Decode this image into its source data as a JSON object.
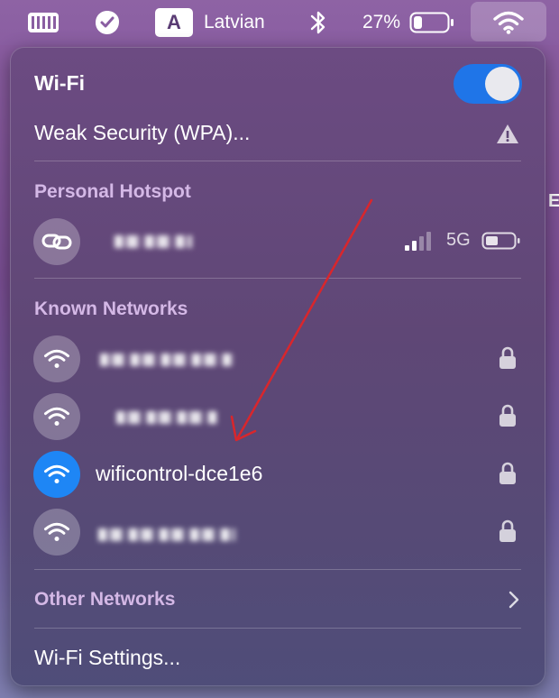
{
  "menubar": {
    "input_source_letter": "A",
    "input_source_label": "Latvian",
    "battery_percent": "27%",
    "battery_level": 0.27,
    "icons": [
      "battery-status-icon",
      "checkmark-badge-icon",
      "bluetooth-icon",
      "battery-icon",
      "wifi-icon"
    ]
  },
  "panel": {
    "title": "Wi-Fi",
    "wifi_enabled": true,
    "current_network_status": "Weak Security (WPA)...",
    "hotspot": {
      "section_title": "Personal Hotspot",
      "network_type": "5G",
      "signal_bars": 2
    },
    "known": {
      "section_title": "Known Networks",
      "networks": [
        {
          "name": "",
          "blurred": true,
          "secured": true,
          "connected": false
        },
        {
          "name": "",
          "blurred": true,
          "secured": true,
          "connected": false
        },
        {
          "name": "wificontrol-dce1e6",
          "blurred": false,
          "secured": true,
          "connected": true
        },
        {
          "name": "",
          "blurred": true,
          "secured": true,
          "connected": false
        }
      ]
    },
    "other_networks_label": "Other Networks",
    "settings_label": "Wi-Fi Settings..."
  },
  "colors": {
    "accent": "#1e86f5",
    "toggle_on": "#1f75e8",
    "annotation_arrow": "#d9262c",
    "section_title": "#d4b8e6"
  }
}
